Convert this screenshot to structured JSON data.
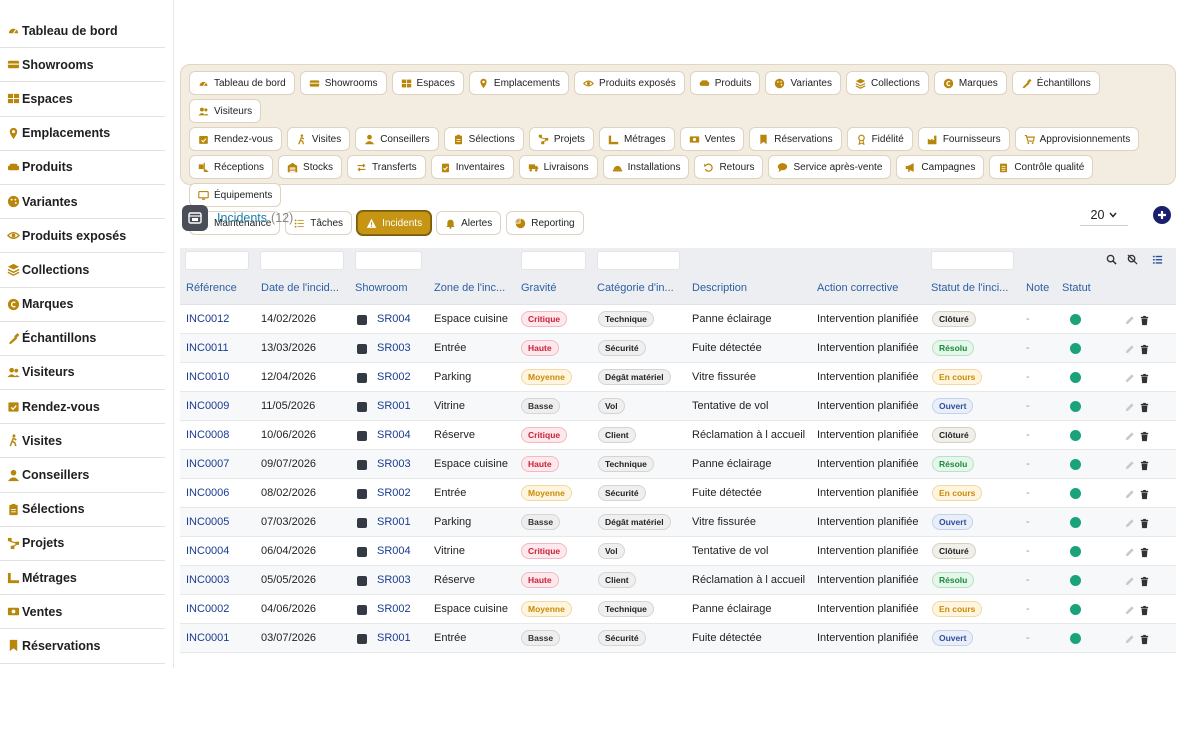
{
  "sidebar": {
    "items": [
      {
        "label": "Tableau de bord",
        "icon": "gauge-icon"
      },
      {
        "label": "Showrooms",
        "icon": "showroom-icon"
      },
      {
        "label": "Espaces",
        "icon": "grid-icon"
      },
      {
        "label": "Emplacements",
        "icon": "map-pin-icon"
      },
      {
        "label": "Produits",
        "icon": "sofa-icon"
      },
      {
        "label": "Variantes",
        "icon": "palette-icon"
      },
      {
        "label": "Produits exposés",
        "icon": "eye-icon"
      },
      {
        "label": "Collections",
        "icon": "layers-icon"
      },
      {
        "label": "Marques",
        "icon": "trademark-icon"
      },
      {
        "label": "Échantillons",
        "icon": "swatch-icon"
      },
      {
        "label": "Visiteurs",
        "icon": "users-icon"
      },
      {
        "label": "Rendez-vous",
        "icon": "calendar-check-icon"
      },
      {
        "label": "Visites",
        "icon": "walking-icon"
      },
      {
        "label": "Conseillers",
        "icon": "user-tie-icon"
      },
      {
        "label": "Sélections",
        "icon": "clipboard-icon"
      },
      {
        "label": "Projets",
        "icon": "project-diagram-icon"
      },
      {
        "label": "Métrages",
        "icon": "ruler-icon"
      },
      {
        "label": "Ventes",
        "icon": "cash-icon"
      },
      {
        "label": "Réservations",
        "icon": "bookmark-icon"
      }
    ]
  },
  "nav": {
    "rows": [
      [
        {
          "label": "Tableau de bord",
          "icon": "gauge-icon"
        },
        {
          "label": "Showrooms",
          "icon": "showroom-icon"
        },
        {
          "label": "Espaces",
          "icon": "grid-icon"
        },
        {
          "label": "Emplacements",
          "icon": "map-pin-icon"
        },
        {
          "label": "Produits exposés",
          "icon": "eye-icon"
        },
        {
          "label": "Produits",
          "icon": "sofa-icon"
        },
        {
          "label": "Variantes",
          "icon": "palette-icon"
        },
        {
          "label": "Collections",
          "icon": "layers-icon"
        },
        {
          "label": "Marques",
          "icon": "trademark-icon"
        },
        {
          "label": "Échantillons",
          "icon": "swatch-icon"
        },
        {
          "label": "Visiteurs",
          "icon": "users-icon"
        }
      ],
      [
        {
          "label": "Rendez-vous",
          "icon": "calendar-check-icon"
        },
        {
          "label": "Visites",
          "icon": "walking-icon"
        },
        {
          "label": "Conseillers",
          "icon": "user-tie-icon"
        },
        {
          "label": "Sélections",
          "icon": "clipboard-icon"
        },
        {
          "label": "Projets",
          "icon": "project-diagram-icon"
        },
        {
          "label": "Métrages",
          "icon": "ruler-icon"
        },
        {
          "label": "Ventes",
          "icon": "cash-icon"
        },
        {
          "label": "Réservations",
          "icon": "bookmark-icon"
        },
        {
          "label": "Fidélité",
          "icon": "award-icon"
        },
        {
          "label": "Fournisseurs",
          "icon": "industry-icon"
        },
        {
          "label": "Approvisionnements",
          "icon": "cart-icon"
        }
      ],
      [
        {
          "label": "Réceptions",
          "icon": "truck-loading-icon"
        },
        {
          "label": "Stocks",
          "icon": "warehouse-icon"
        },
        {
          "label": "Transferts",
          "icon": "exchange-icon"
        },
        {
          "label": "Inventaires",
          "icon": "clipboard-check-icon"
        },
        {
          "label": "Livraisons",
          "icon": "truck-icon"
        },
        {
          "label": "Installations",
          "icon": "hard-hat-icon"
        },
        {
          "label": "Retours",
          "icon": "undo-icon"
        },
        {
          "label": "Service après-vente",
          "icon": "comment-icon"
        },
        {
          "label": "Campagnes",
          "icon": "megaphone-icon"
        },
        {
          "label": "Contrôle qualité",
          "icon": "clipboard-list-icon"
        },
        {
          "label": "Équipements",
          "icon": "monitor-icon"
        }
      ],
      [
        {
          "label": "Maintenance",
          "icon": "tools-icon"
        },
        {
          "label": "Tâches",
          "icon": "tasks-icon"
        },
        {
          "label": "Incidents",
          "icon": "warning-icon",
          "active": true
        },
        {
          "label": "Alertes",
          "icon": "bell-icon"
        },
        {
          "label": "Reporting",
          "icon": "pie-chart-icon"
        }
      ]
    ]
  },
  "header": {
    "title": "Incidents",
    "count": "(12)",
    "page_size": "20"
  },
  "table": {
    "columns": [
      "Référence",
      "Date de l'incid...",
      "Showroom",
      "Zone de l'inc...",
      "Gravité",
      "Catégorie d'in...",
      "Description",
      "Action corrective",
      "Statut de l'inci...",
      "Note",
      "Statut"
    ],
    "rows": [
      {
        "ref": "INC0012",
        "date": "14/02/2026",
        "showroom": "SR004",
        "zone": "Espace cuisine",
        "gravite": "Critique",
        "categorie": "Technique",
        "description": "Panne éclairage",
        "action": "Intervention planifiée",
        "statut": "Clôturé",
        "note": "-"
      },
      {
        "ref": "INC0011",
        "date": "13/03/2026",
        "showroom": "SR003",
        "zone": "Entrée",
        "gravite": "Haute",
        "categorie": "Sécurité",
        "description": "Fuite détectée",
        "action": "Intervention planifiée",
        "statut": "Résolu",
        "note": "-"
      },
      {
        "ref": "INC0010",
        "date": "12/04/2026",
        "showroom": "SR002",
        "zone": "Parking",
        "gravite": "Moyenne",
        "categorie": "Dégât matériel",
        "description": "Vitre fissurée",
        "action": "Intervention planifiée",
        "statut": "En cours",
        "note": "-"
      },
      {
        "ref": "INC0009",
        "date": "11/05/2026",
        "showroom": "SR001",
        "zone": "Vitrine",
        "gravite": "Basse",
        "categorie": "Vol",
        "description": "Tentative de vol",
        "action": "Intervention planifiée",
        "statut": "Ouvert",
        "note": "-"
      },
      {
        "ref": "INC0008",
        "date": "10/06/2026",
        "showroom": "SR004",
        "zone": "Réserve",
        "gravite": "Critique",
        "categorie": "Client",
        "description": "Réclamation à l accueil",
        "action": "Intervention planifiée",
        "statut": "Clôturé",
        "note": "-"
      },
      {
        "ref": "INC0007",
        "date": "09/07/2026",
        "showroom": "SR003",
        "zone": "Espace cuisine",
        "gravite": "Haute",
        "categorie": "Technique",
        "description": "Panne éclairage",
        "action": "Intervention planifiée",
        "statut": "Résolu",
        "note": "-"
      },
      {
        "ref": "INC0006",
        "date": "08/02/2026",
        "showroom": "SR002",
        "zone": "Entrée",
        "gravite": "Moyenne",
        "categorie": "Sécurité",
        "description": "Fuite détectée",
        "action": "Intervention planifiée",
        "statut": "En cours",
        "note": "-"
      },
      {
        "ref": "INC0005",
        "date": "07/03/2026",
        "showroom": "SR001",
        "zone": "Parking",
        "gravite": "Basse",
        "categorie": "Dégât matériel",
        "description": "Vitre fissurée",
        "action": "Intervention planifiée",
        "statut": "Ouvert",
        "note": "-"
      },
      {
        "ref": "INC0004",
        "date": "06/04/2026",
        "showroom": "SR004",
        "zone": "Vitrine",
        "gravite": "Critique",
        "categorie": "Vol",
        "description": "Tentative de vol",
        "action": "Intervention planifiée",
        "statut": "Clôturé",
        "note": "-"
      },
      {
        "ref": "INC0003",
        "date": "05/05/2026",
        "showroom": "SR003",
        "zone": "Réserve",
        "gravite": "Haute",
        "categorie": "Client",
        "description": "Réclamation à l accueil",
        "action": "Intervention planifiée",
        "statut": "Résolu",
        "note": "-"
      },
      {
        "ref": "INC0002",
        "date": "04/06/2026",
        "showroom": "SR002",
        "zone": "Espace cuisine",
        "gravite": "Moyenne",
        "categorie": "Technique",
        "description": "Panne éclairage",
        "action": "Intervention planifiée",
        "statut": "En cours",
        "note": "-"
      },
      {
        "ref": "INC0001",
        "date": "03/07/2026",
        "showroom": "SR001",
        "zone": "Entrée",
        "gravite": "Basse",
        "categorie": "Sécurité",
        "description": "Fuite détectée",
        "action": "Intervention planifiée",
        "statut": "Ouvert",
        "note": "-"
      }
    ]
  },
  "colors": {
    "accent": "#c79514",
    "sidebar_icon": "#b8860b",
    "link": "#1e7fa8",
    "status_active": "#1aa37a",
    "add_button": "#1a1f6e"
  }
}
